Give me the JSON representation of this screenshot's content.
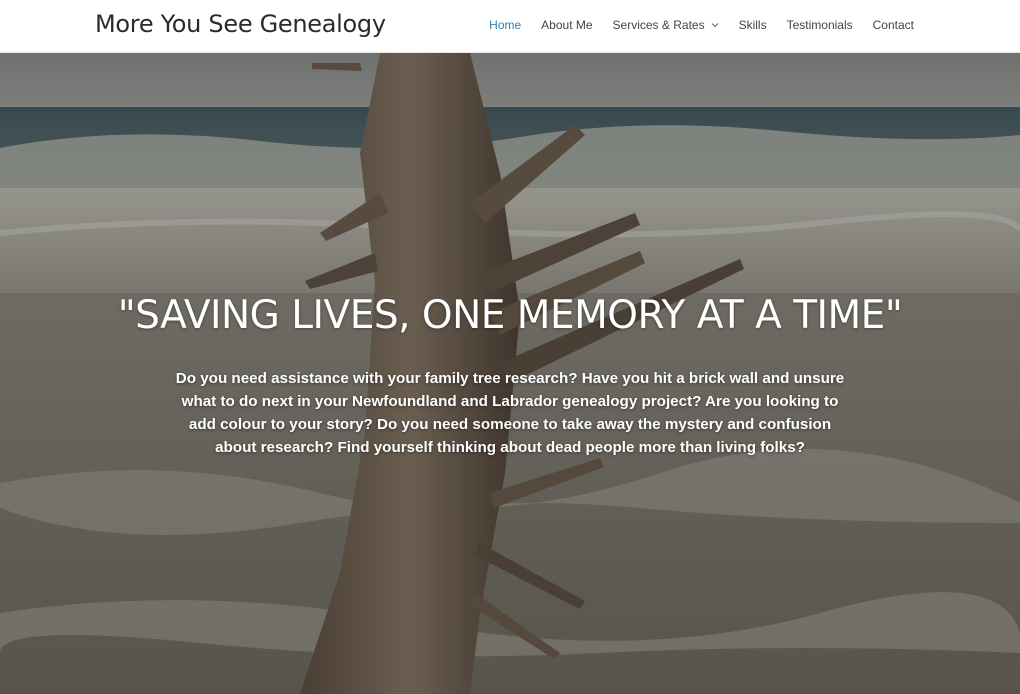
{
  "site": {
    "title": "More You See Genealogy"
  },
  "nav": {
    "items": [
      {
        "label": "Home",
        "active": true
      },
      {
        "label": "About Me",
        "active": false
      },
      {
        "label": "Services & Rates",
        "active": false,
        "has_dropdown": true
      },
      {
        "label": "Skills",
        "active": false
      },
      {
        "label": "Testimonials",
        "active": false
      },
      {
        "label": "Contact",
        "active": false
      }
    ]
  },
  "hero": {
    "heading": "\"SAVING LIVES, ONE MEMORY AT A TIME\"",
    "body": "Do you need assistance with your family tree research? Have you hit a brick wall and unsure what to do next in your Newfoundland and Labrador genealogy project? Are you looking to add colour to your story? Do you need someone to take away the mystery and confusion about research? Find yourself thinking about dead people more than living folks?"
  },
  "colors": {
    "nav_active": "#2f7fb5",
    "nav_default": "#444444",
    "title": "#2b2b2b",
    "hero_text": "#ffffff"
  },
  "icons": {
    "dropdown": "chevron-down-icon"
  }
}
